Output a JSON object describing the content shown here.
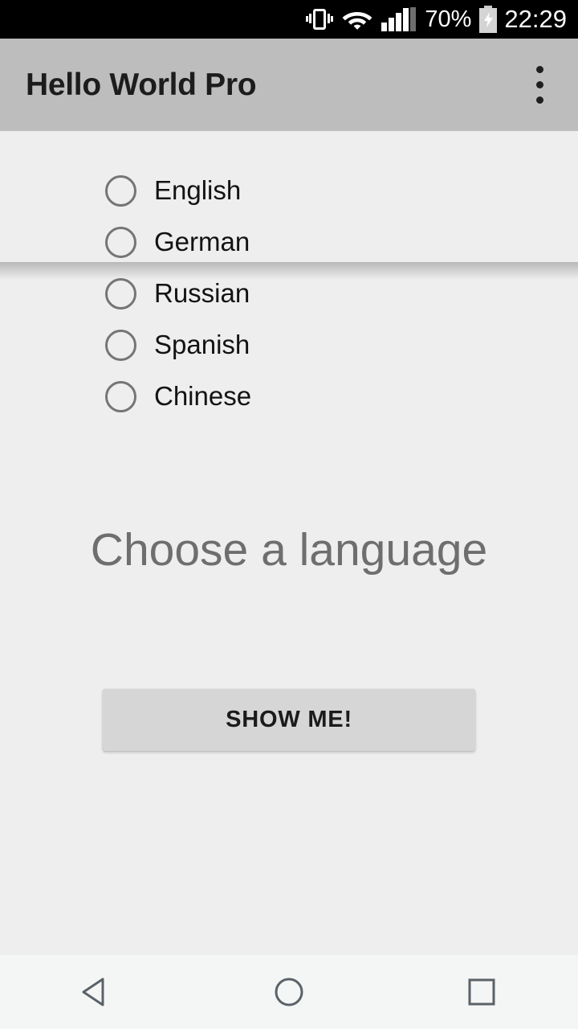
{
  "status_bar": {
    "vibrate_icon": "vibrate-icon",
    "wifi_icon": "wifi-icon",
    "signal_icon": "signal-bars-icon",
    "battery_percent": "70%",
    "battery_icon": "battery-charging-icon",
    "clock": "22:29",
    "background_color": "#000000",
    "text_color": "#ffffff"
  },
  "app_bar": {
    "title": "Hello World Pro",
    "overflow_icon": "overflow-menu-icon",
    "background_color": "#bdbdbd",
    "title_color": "#1c1c1c"
  },
  "content": {
    "background_color": "#eeeeee",
    "radio_group": {
      "name": "language",
      "selected": null,
      "options": [
        {
          "label": "English",
          "checked": false
        },
        {
          "label": "German",
          "checked": false
        },
        {
          "label": "Russian",
          "checked": false
        },
        {
          "label": "Spanish",
          "checked": false
        },
        {
          "label": "Chinese",
          "checked": false
        }
      ]
    },
    "headline": "Choose a language",
    "headline_color": "#6e6e6e",
    "button": {
      "label": "SHOW ME!",
      "background_color": "#d6d6d6",
      "text_color": "#1b1b1b"
    }
  },
  "nav_bar": {
    "background_color": "#f4f5f5",
    "icon_color": "#5a6268",
    "buttons": [
      {
        "name": "back",
        "icon": "back-triangle-icon"
      },
      {
        "name": "home",
        "icon": "home-circle-icon"
      },
      {
        "name": "recents",
        "icon": "recents-square-icon"
      }
    ]
  }
}
